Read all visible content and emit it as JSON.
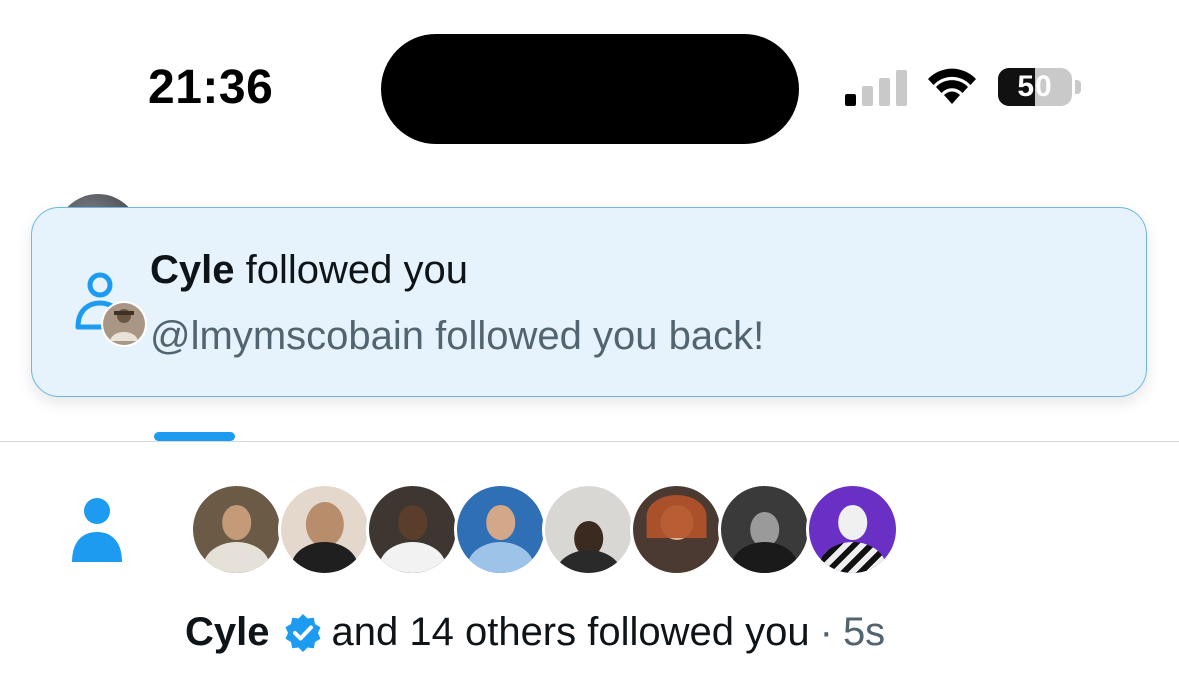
{
  "status_bar": {
    "time": "21:36",
    "battery_level": "50",
    "battery_fraction": 0.5,
    "signal_bars_active": 1,
    "signal_bars_total": 4
  },
  "toast": {
    "title_name": "Cyle",
    "title_action": "followed you",
    "subtitle": "@lmymscobain followed you back!",
    "icon": "follow-person-icon"
  },
  "notification": {
    "icon": "person-icon",
    "avatar_count": 8,
    "name": "Cyle",
    "verified_icon": "verified-badge-icon",
    "text": "and 14 others followed you",
    "separator": "·",
    "time": "5s"
  },
  "colors": {
    "accent": "#1d9bf0",
    "toast_background": "#e7f3fc",
    "secondary_text": "#536471"
  }
}
